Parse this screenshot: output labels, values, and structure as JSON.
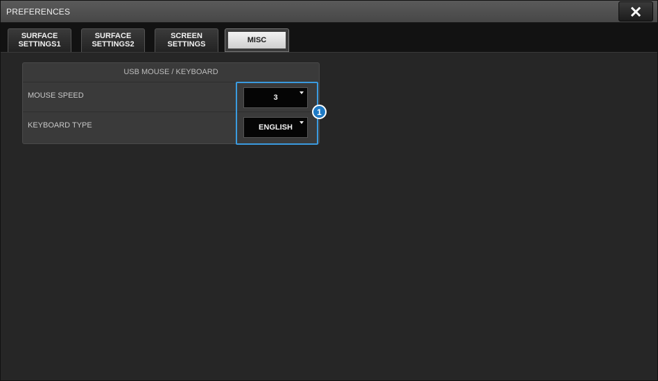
{
  "window": {
    "title": "PREFERENCES",
    "close_icon": "close-x-icon"
  },
  "tabs": [
    {
      "line1": "SURFACE",
      "line2": "SETTINGS1",
      "active": false
    },
    {
      "line1": "SURFACE",
      "line2": "SETTINGS2",
      "active": false
    },
    {
      "line1": "SCREEN",
      "line2": "SETTINGS",
      "active": false
    },
    {
      "label": "MISC",
      "active": true
    }
  ],
  "panel": {
    "title": "USB MOUSE / KEYBOARD",
    "rows": [
      {
        "label": "MOUSE SPEED",
        "value": "3"
      },
      {
        "label": "KEYBOARD TYPE",
        "value": "ENGLISH"
      }
    ]
  },
  "callout": {
    "number": "1",
    "color": "#1f7ac4"
  }
}
